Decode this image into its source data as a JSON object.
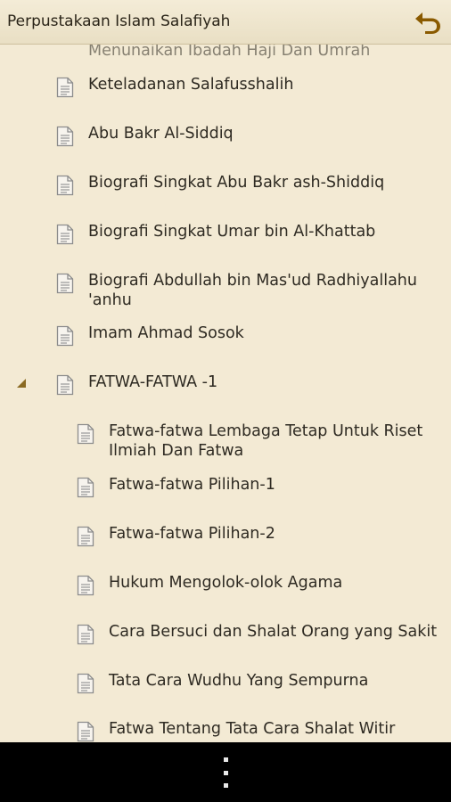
{
  "app": {
    "title": "Perpustakaan Islam Salafiyah",
    "back_icon": "undo-arrow-icon",
    "accent_color": "#8a5a00"
  },
  "tree": {
    "items": [
      {
        "label": "Menunaikan Ibadah Haji Dan Umrah",
        "level": 0,
        "icon": "document-icon",
        "partial": true
      },
      {
        "label": "Keteladanan Salafusshalih",
        "level": 0,
        "icon": "document-icon"
      },
      {
        "label": "Abu Bakr Al-Siddiq",
        "level": 0,
        "icon": "document-icon"
      },
      {
        "label": "Biografi Singkat Abu Bakr ash-Shiddiq",
        "level": 0,
        "icon": "document-icon"
      },
      {
        "label": "Biografi Singkat Umar bin Al-Khattab",
        "level": 0,
        "icon": "document-icon"
      },
      {
        "label": "Biografi Abdullah bin Mas'ud Radhiyallahu 'anhu",
        "level": 0,
        "icon": "document-icon"
      },
      {
        "label": "Imam Ahmad Sosok",
        "level": 0,
        "icon": "document-icon"
      },
      {
        "label": "FATWA-FATWA -1",
        "level": 0,
        "icon": "document-icon",
        "expanded": true
      },
      {
        "label": "Fatwa-fatwa Lembaga Tetap Untuk Riset Ilmiah Dan Fatwa",
        "level": 1,
        "icon": "document-icon"
      },
      {
        "label": "Fatwa-fatwa Pilihan-1",
        "level": 1,
        "icon": "document-icon"
      },
      {
        "label": "Fatwa-fatwa Pilihan-2",
        "level": 1,
        "icon": "document-icon"
      },
      {
        "label": "Hukum Mengolok-olok Agama",
        "level": 1,
        "icon": "document-icon"
      },
      {
        "label": "Cara Bersuci dan Shalat Orang yang Sakit",
        "level": 1,
        "icon": "document-icon"
      },
      {
        "label": "Tata Cara Wudhu Yang Sempurna",
        "level": 1,
        "icon": "document-icon"
      },
      {
        "label": "Fatwa Tentang Tata Cara Shalat Witir",
        "level": 1,
        "icon": "document-icon",
        "partial": true
      }
    ]
  },
  "navbar": {
    "menu_icon": "overflow-menu-icon"
  }
}
